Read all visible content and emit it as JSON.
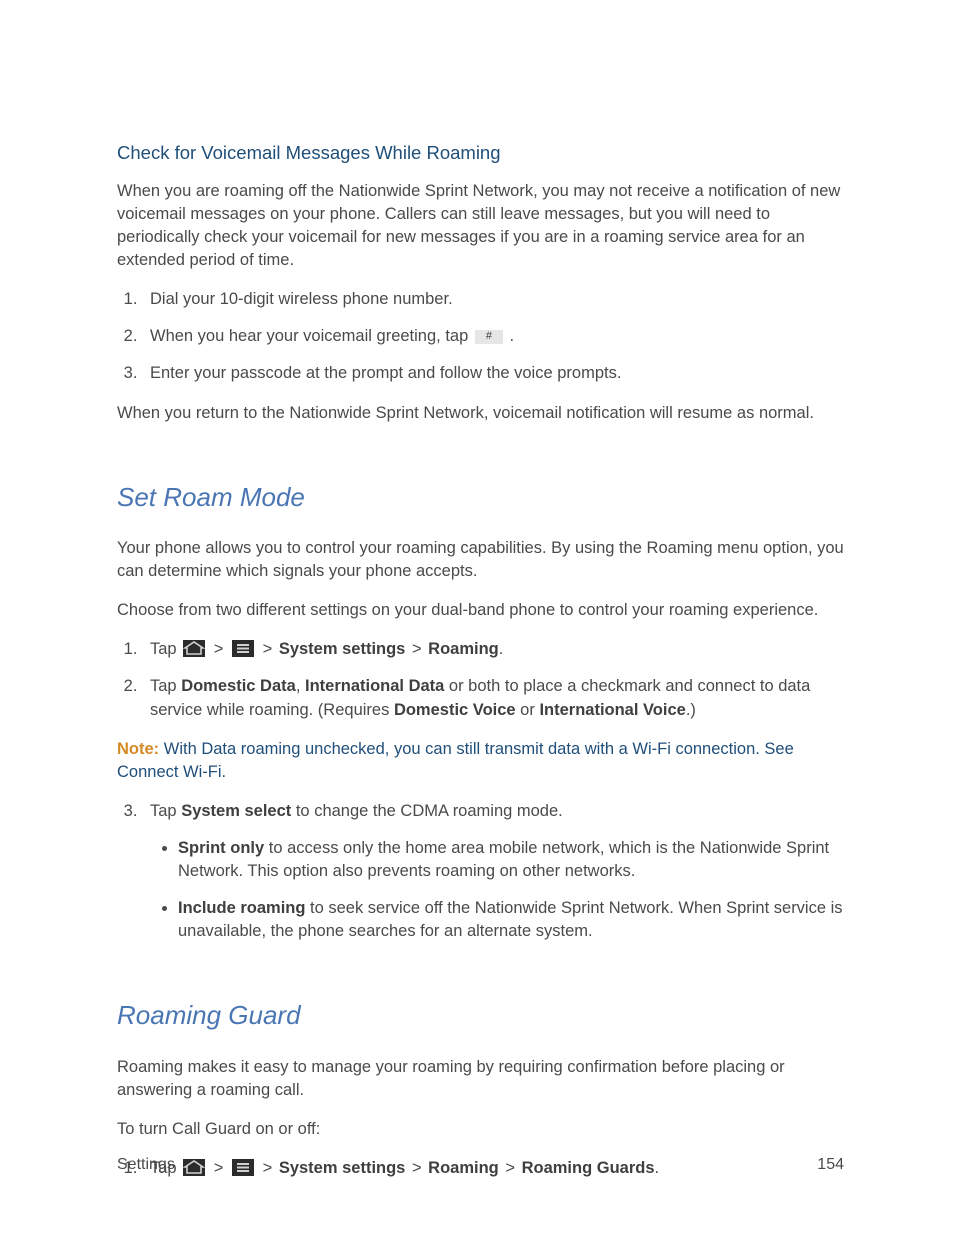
{
  "sec1": {
    "heading": "Check for Voicemail Messages While Roaming",
    "intro": "When you are roaming off the Nationwide Sprint Network, you may not receive a notification of new voicemail messages on your phone. Callers can still leave messages, but you will need to periodically check your voicemail for new messages if you are in a roaming service area for an extended period of time.",
    "step1": "Dial your 10-digit wireless phone number.",
    "step2_a": "When you hear your voicemail greeting, tap ",
    "step2_key": "#",
    "step2_b": " .",
    "step3": "Enter your passcode at the prompt and follow the voice prompts.",
    "outro": "When you return to the Nationwide Sprint Network, voicemail notification will resume as normal."
  },
  "sec2": {
    "heading": "Set Roam Mode",
    "p1": "Your phone allows you to control your roaming capabilities. By using the Roaming menu option, you can determine which signals your phone accepts.",
    "p2": "Choose from two different settings on your dual-band phone to control your roaming experience.",
    "step1_a": "Tap ",
    "step1_sep1": " > ",
    "step1_sep2": " > ",
    "step1_b1": "System settings",
    "step1_sep3": " > ",
    "step1_b2": "Roaming",
    "step1_end": ".",
    "step2_a": "Tap ",
    "step2_b1": "Domestic Data",
    "step2_m1": ", ",
    "step2_b2": "International Data",
    "step2_m2": " or both to place a checkmark and connect to data service while roaming. (Requires ",
    "step2_b3": "Domestic Voice",
    "step2_m3": " or ",
    "step2_b4": "International Voice",
    "step2_end": ".)",
    "note_label": "Note:",
    "note_body": "  With Data roaming unchecked, you can still transmit data with a Wi-Fi connection. See Connect Wi-Fi.",
    "step3_a": "Tap ",
    "step3_b": "System select",
    "step3_c": " to change the CDMA roaming mode.",
    "sub1_b": "Sprint only",
    "sub1_t": " to access only the home area mobile network, which is the Nationwide Sprint Network. This option also prevents roaming on other networks.",
    "sub2_b": "Include roaming",
    "sub2_t": " to seek service off the Nationwide Sprint Network. When Sprint service is unavailable, the phone searches for an alternate system."
  },
  "sec3": {
    "heading": "Roaming Guard",
    "p1": "Roaming makes it easy to manage your roaming by requiring confirmation before placing or answering a roaming call.",
    "p2": "To turn Call Guard on or off:",
    "step1_a": "Tap ",
    "step1_sep1": " > ",
    "step1_sep2": " > ",
    "step1_b1": "System settings",
    "step1_sep3": " > ",
    "step1_b2": "Roaming",
    "step1_sep4": " > ",
    "step1_b3": "Roaming Guards",
    "step1_end": "."
  },
  "footer": {
    "section": "Settings",
    "page": "154"
  }
}
